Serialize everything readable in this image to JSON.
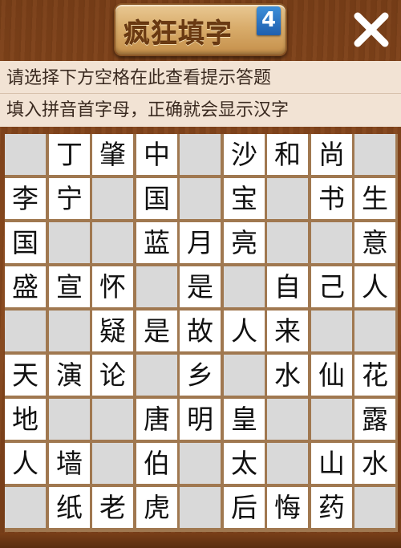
{
  "header": {
    "title": "疯狂填字",
    "level": "4"
  },
  "hints": {
    "line1": "请选择下方空格在此查看提示答题",
    "line2": "填入拼音首字母，正确就会显示汉字"
  },
  "colors": {
    "letter_cell": "#ffffff",
    "blank_cell": "#d9d9d9",
    "background": "#7a3f18",
    "hint_panel": "#f2e3d4",
    "level_badge": "#2a73c2"
  },
  "grid": {
    "rows": [
      [
        "",
        "丁",
        "肇",
        "中",
        "",
        "沙",
        "和",
        "尚",
        ""
      ],
      [
        "李",
        "宁",
        "",
        "国",
        "",
        "宝",
        "",
        "书",
        "生"
      ],
      [
        "国",
        "",
        "",
        "蓝",
        "月",
        "亮",
        "",
        "",
        "意"
      ],
      [
        "盛",
        "宣",
        "怀",
        "",
        "是",
        "",
        "自",
        "己",
        "人"
      ],
      [
        "",
        "",
        "疑",
        "是",
        "故",
        "人",
        "来",
        "",
        ""
      ],
      [
        "天",
        "演",
        "论",
        "",
        "乡",
        "",
        "水",
        "仙",
        "花"
      ],
      [
        "地",
        "",
        "",
        "唐",
        "明",
        "皇",
        "",
        "",
        "露"
      ],
      [
        "人",
        "墙",
        "",
        "伯",
        "",
        "太",
        "",
        "山",
        "水"
      ],
      [
        "",
        "纸",
        "老",
        "虎",
        "",
        "后",
        "悔",
        "药",
        ""
      ]
    ]
  }
}
